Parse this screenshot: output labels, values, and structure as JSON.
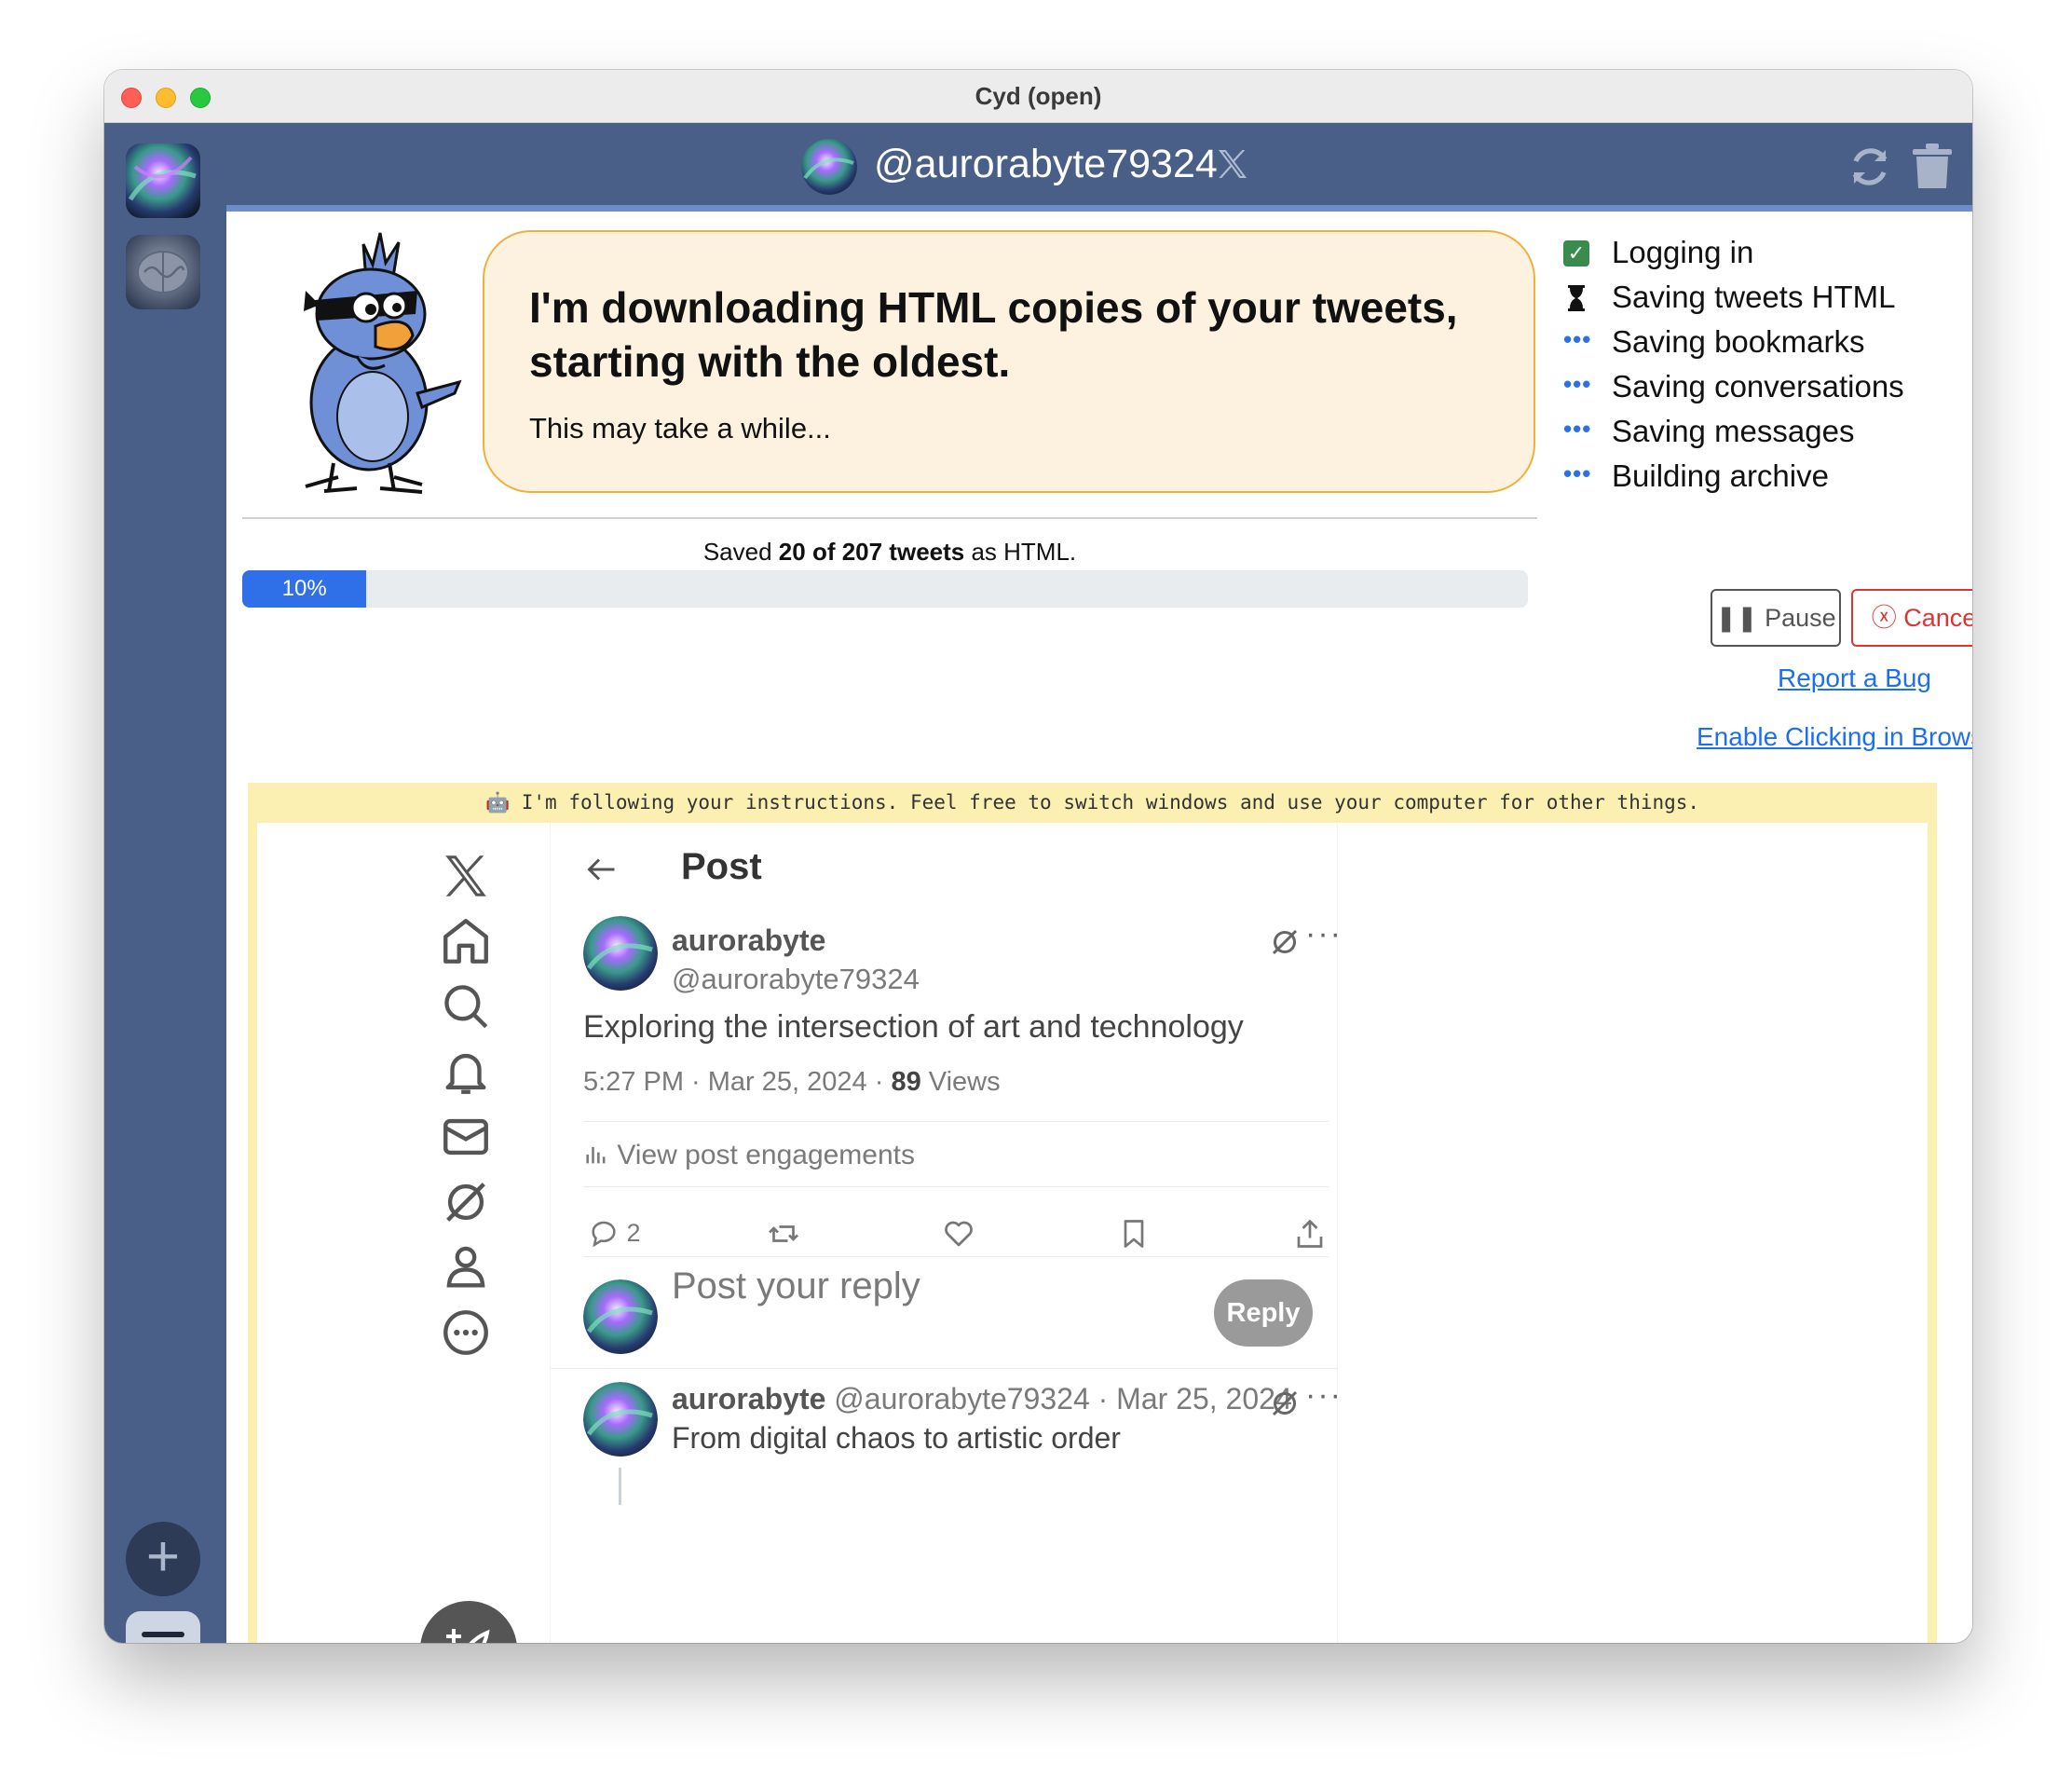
{
  "window": {
    "title": "Cyd (open)"
  },
  "header": {
    "username": "@aurorabyte79324"
  },
  "banner": {
    "title": "I'm downloading HTML copies of your tweets, starting with the oldest.",
    "subtitle": "This may take a while..."
  },
  "progress": {
    "prefix": "Saved ",
    "count": "20 of 207 tweets",
    "suffix": " as HTML.",
    "percent_label": "10%",
    "fraction": 0.0966
  },
  "steps": [
    {
      "label": "Logging in",
      "state": "done"
    },
    {
      "label": "Saving tweets HTML",
      "state": "active"
    },
    {
      "label": "Saving bookmarks",
      "state": "pending"
    },
    {
      "label": "Saving conversations",
      "state": "pending"
    },
    {
      "label": "Saving messages",
      "state": "pending"
    },
    {
      "label": "Building archive",
      "state": "pending"
    }
  ],
  "controls": {
    "pause_label": "Pause",
    "cancel_label": "Cancel",
    "report_bug": "Report a Bug",
    "enable_clicking": "Enable Clicking in Browser"
  },
  "browser": {
    "notice": "I'm following your instructions. Feel free to switch windows and use your computer for other things.",
    "page_title": "Post",
    "post": {
      "name": "aurorabyte",
      "handle": "@aurorabyte79324",
      "text": "Exploring the intersection of art and technology",
      "time": "5:27 PM · Mar 25, 2024 · ",
      "views_count": "89",
      "views_label": " Views",
      "engagements": "View post engagements",
      "reply_count": "2"
    },
    "reply_box": {
      "placeholder": "Post your reply",
      "button": "Reply"
    },
    "reply": {
      "name": "aurorabyte",
      "meta": " @aurorabyte79324 · Mar 25, 2024",
      "text": "From digital chaos to artistic order"
    }
  },
  "colors": {
    "sidebar": "#4a5f88",
    "accent": "#2f6fe8",
    "bubble": "#fcf2df",
    "cancel": "#dd3333"
  }
}
